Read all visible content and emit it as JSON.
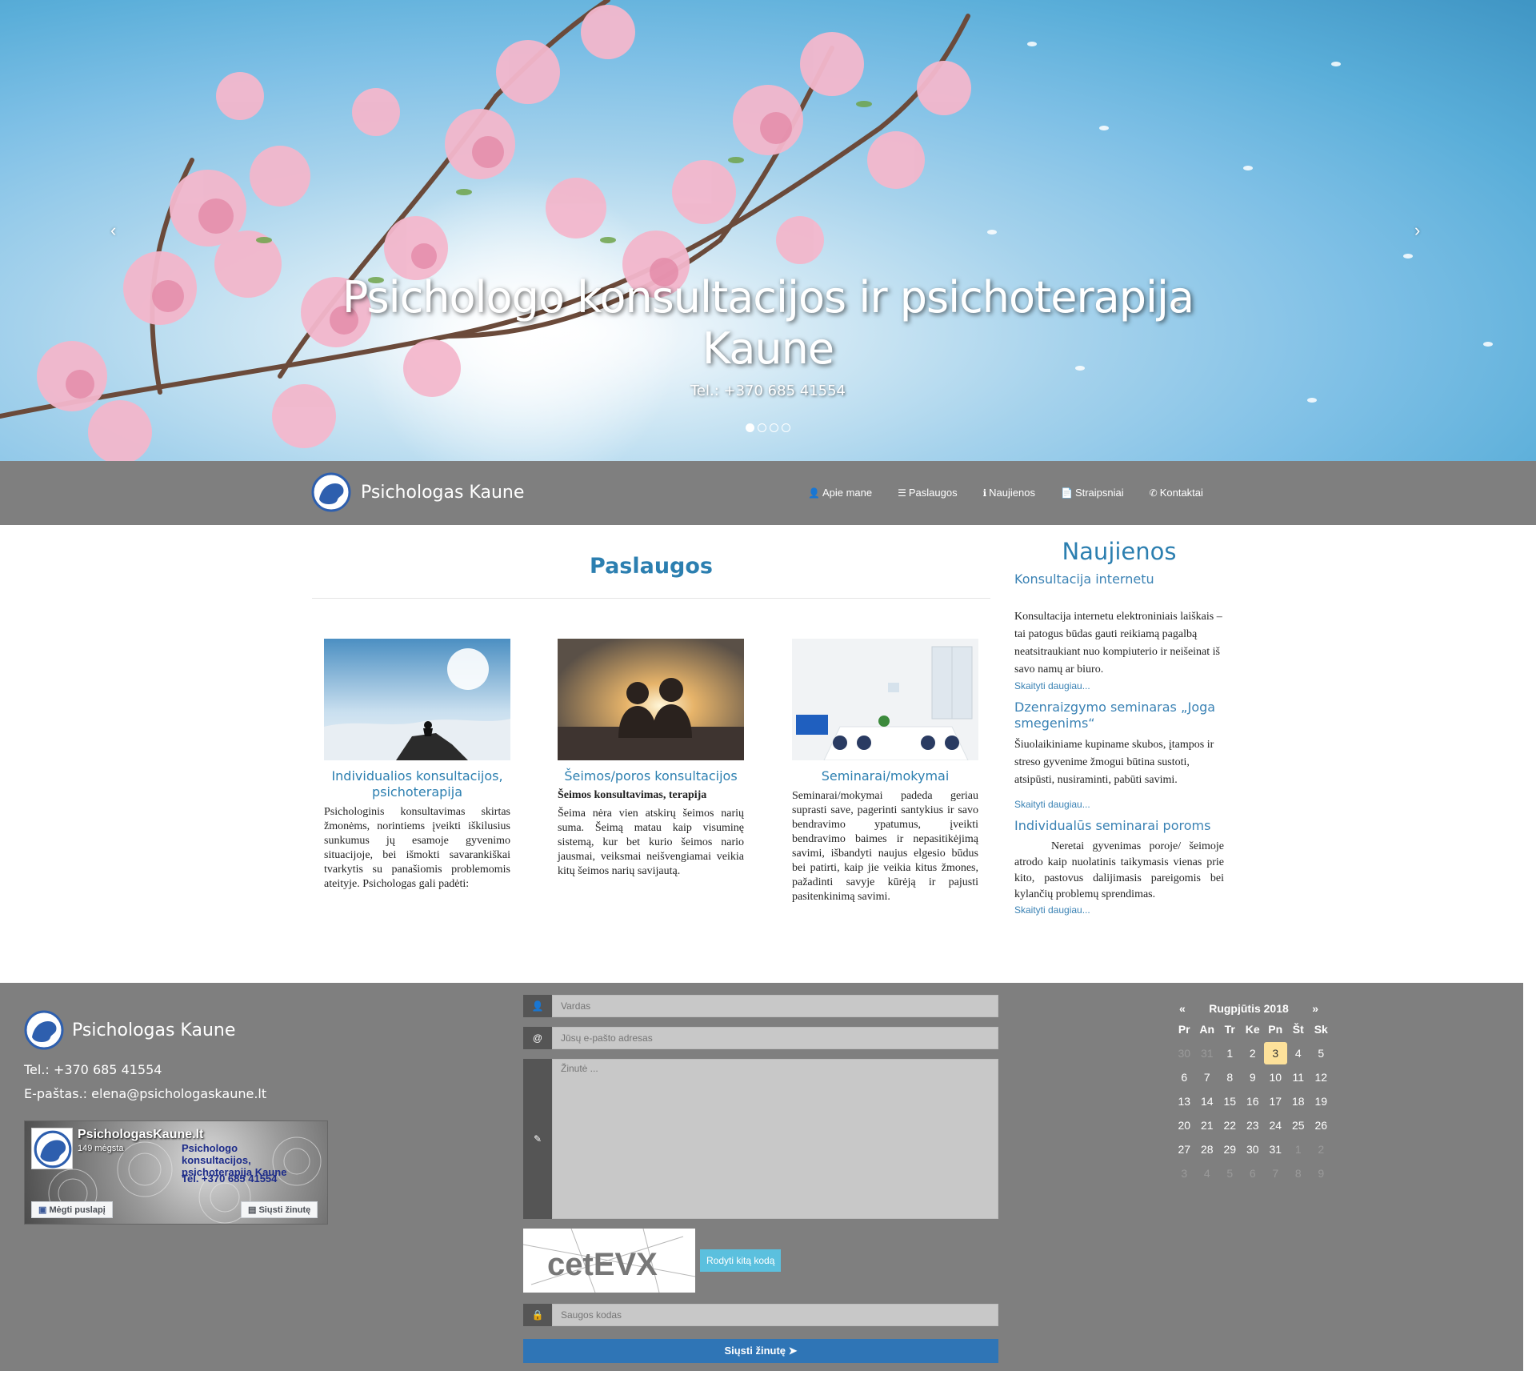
{
  "hero": {
    "title": "Psichologo konsultacijos ir psichoterapija Kaune",
    "phone": "Tel.: +370 685 41554",
    "prev": "‹",
    "next": "›",
    "slides": 4,
    "active_slide": 1
  },
  "navbar": {
    "brand": "Psichologas Kaune",
    "items": [
      {
        "icon": "user-icon",
        "glyph": "👤",
        "label": "Apie mane"
      },
      {
        "icon": "list-icon",
        "glyph": "☰",
        "label": "Paslaugos"
      },
      {
        "icon": "info-icon",
        "glyph": "ℹ",
        "label": "Naujienos"
      },
      {
        "icon": "document-icon",
        "glyph": "📄",
        "label": "Straipsniai"
      },
      {
        "icon": "phone-icon",
        "glyph": "✆",
        "label": "Kontaktai"
      }
    ]
  },
  "services": {
    "title": "Paslaugos",
    "cards": [
      {
        "title": "Individualios konsultacijos, psichoterapija",
        "subtitle": "",
        "text": "Psichologinis konsultavimas skirtas žmonėms, norintiems įveikti iškilusius sunkumus jų esamoje gyvenimo situacijoje, bei išmokti savarankiškai tvarkytis su panašiomis problemomis ateityje. Psichologas gali padėti:"
      },
      {
        "title": "Šeimos/poros konsultacijos",
        "subtitle": "Šeimos konsultavimas, terapija",
        "text": "Šeima nėra vien atskirų šeimos narių suma. Šeimą matau kaip visuminę sistemą, kur bet kurio šeimos nario jausmai, veiksmai neišvengiamai veikia kitų šeimos narių savijautą."
      },
      {
        "title": "Seminarai/mokymai",
        "subtitle": "",
        "text": "Seminarai/mokymai padeda geriau suprasti save, pagerinti santykius ir savo bendravimo ypatumus, įveikti bendravimo baimes ir nepasitikėjimą savimi, išbandyti naujus elgesio būdus bei patirti, kaip jie veikia kitus žmones, pažadinti savyje kūrėją ir pajusti pasitenkinimą savimi."
      }
    ]
  },
  "news": {
    "title": "Naujienos",
    "more": "Skaityti daugiau...",
    "items": [
      {
        "title": "Konsultacija internetu",
        "text": "Konsultacija internetu elektroniniais laiškais – tai patogus būdas gauti reikiamą pagalbą neatsitraukiant nuo kompiuterio ir neišeinat iš savo namų ar biuro."
      },
      {
        "title": "Dzenraizgymo seminaras „Joga smegenims“",
        "text": "Šiuolaikiniame kupiname skubos, įtampos ir streso gyvenime žmogui būtina sustoti, atsipūsti, nusiraminti, pabūti savimi."
      },
      {
        "title": "Individualūs seminarai poroms",
        "text": "Neretai gyvenimas poroje/ šeimoje atrodo kaip nuolatinis taikymasis vienas prie kito, pastovus dalijimasis pareigomis bei kylančių problemų sprendimas."
      }
    ]
  },
  "footer": {
    "brand": "Psichologas Kaune",
    "phone": "Tel.:  +370 685 41554",
    "email": "E-paštas.: elena@psichologaskaune.lt",
    "fb": {
      "name": "PsichologasKaune.lt",
      "likes": "149 mėgsta",
      "overlay_1": "Psichologo konsultacijos, psichoterapija Kaune",
      "overlay_2": "Tel. +370 685 41554",
      "like_button": "Mėgti puslapį",
      "message_button": "Siųsti žinutę"
    },
    "form": {
      "name_placeholder": "Vardas",
      "email_placeholder": "Jūsų e-pašto adresas",
      "message_placeholder": "Žinutė ...",
      "captcha_text": "cetEVX",
      "captcha_refresh": "Rodyti kitą kodą",
      "code_placeholder": "Saugos kodas",
      "send_label": "Siųsti žinutę ➤"
    },
    "calendar": {
      "title": "Rugpjūtis 2018",
      "prev": "«",
      "next": "»",
      "weekdays": [
        "Pr",
        "An",
        "Tr",
        "Ke",
        "Pn",
        "Št",
        "Sk"
      ],
      "today": "3",
      "weeks": [
        [
          "30",
          "31",
          "1",
          "2",
          "3",
          "4",
          "5"
        ],
        [
          "6",
          "7",
          "8",
          "9",
          "10",
          "11",
          "12"
        ],
        [
          "13",
          "14",
          "15",
          "16",
          "17",
          "18",
          "19"
        ],
        [
          "20",
          "21",
          "22",
          "23",
          "24",
          "25",
          "26"
        ],
        [
          "27",
          "28",
          "29",
          "30",
          "31",
          "1",
          "2"
        ],
        [
          "3",
          "4",
          "5",
          "6",
          "7",
          "8",
          "9"
        ]
      ]
    }
  }
}
